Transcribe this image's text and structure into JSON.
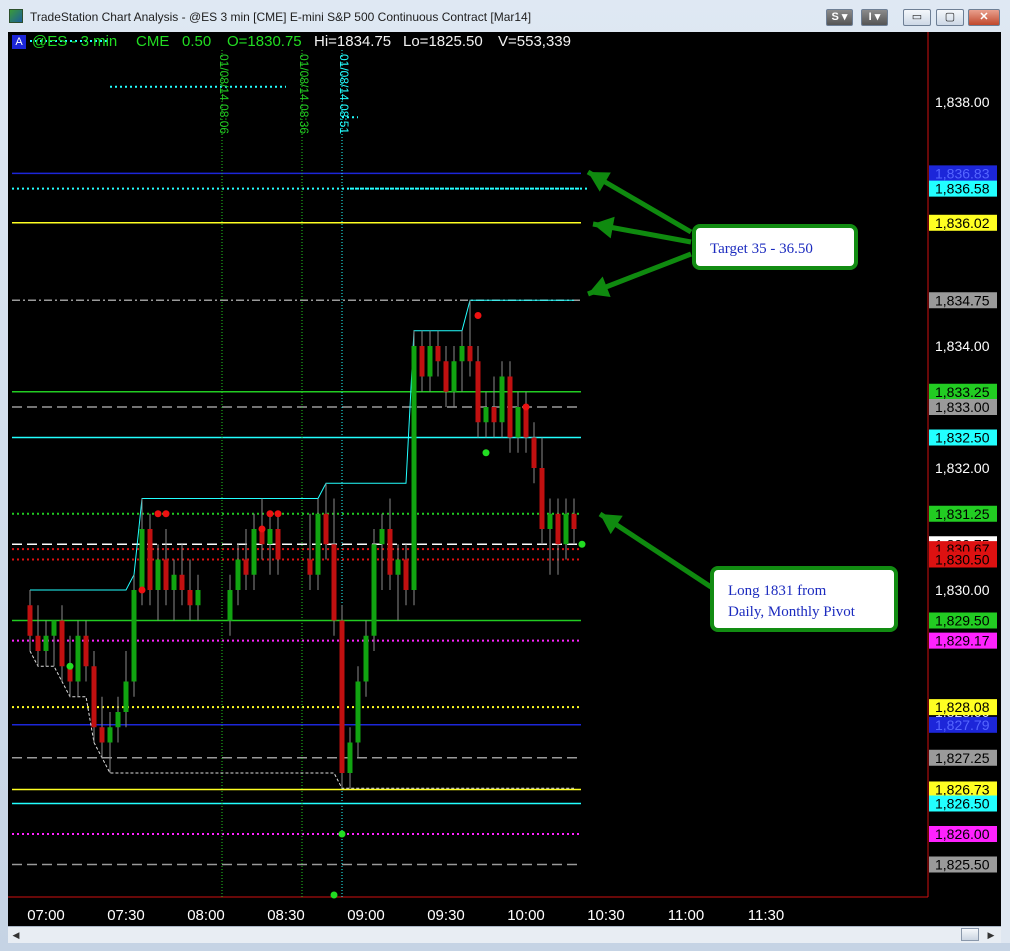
{
  "window": {
    "title": "TradeStation Chart Analysis - @ES 3 min [CME] E-mini S&P 500 Continuous Contract [Mar14]",
    "buttons": [
      "S ▾",
      "I ▾",
      "▭",
      "▢",
      "✕"
    ]
  },
  "header": {
    "a_label": "A",
    "symbol": "@ES - 3 min",
    "exchange": "CME",
    "tick": "0.50",
    "open": "O=1830.75",
    "high": "Hi=1834.75",
    "low": "Lo=1825.50",
    "volume": "V=553,339"
  },
  "colors": {
    "up": "#11a411",
    "down": "#c11010",
    "wick": "#8a8a8a",
    "blue": "#1c26d9",
    "yellow": "#ffff22",
    "green": "#22cc22",
    "cyan": "#22ffff",
    "magenta": "#ff22ff",
    "gray": "#9a9a9a",
    "arrow": "#0f8a0f"
  },
  "chart_data": {
    "type": "candlestick",
    "bar_interval_min": 3,
    "x_ticks": [
      "07:00",
      "07:30",
      "08:00",
      "08:30",
      "09:00",
      "09:30",
      "10:00",
      "10:30",
      "11:00",
      "11:30"
    ],
    "y_ticks": [
      "1,838.00",
      "1,836.00",
      "1,834.00",
      "1,832.00",
      "1,830.00",
      "1,828.00",
      "1,826.00"
    ],
    "bars": [
      {
        "t": "06:54",
        "o": 1829.75,
        "h": 1830.0,
        "l": 1829.0,
        "c": 1829.25
      },
      {
        "t": "06:57",
        "o": 1829.25,
        "h": 1829.75,
        "l": 1828.75,
        "c": 1829.0
      },
      {
        "t": "07:00",
        "o": 1829.0,
        "h": 1829.5,
        "l": 1828.75,
        "c": 1829.25
      },
      {
        "t": "07:03",
        "o": 1829.25,
        "h": 1829.5,
        "l": 1828.75,
        "c": 1829.5
      },
      {
        "t": "07:06",
        "o": 1829.5,
        "h": 1829.75,
        "l": 1828.5,
        "c": 1828.75
      },
      {
        "t": "07:09",
        "o": 1828.75,
        "h": 1829.25,
        "l": 1828.25,
        "c": 1828.5
      },
      {
        "t": "07:12",
        "o": 1828.5,
        "h": 1829.5,
        "l": 1828.25,
        "c": 1829.25
      },
      {
        "t": "07:15",
        "o": 1829.25,
        "h": 1829.5,
        "l": 1828.5,
        "c": 1828.75
      },
      {
        "t": "07:18",
        "o": 1828.75,
        "h": 1829.0,
        "l": 1827.5,
        "c": 1827.75
      },
      {
        "t": "07:21",
        "o": 1827.75,
        "h": 1828.25,
        "l": 1827.25,
        "c": 1827.5
      },
      {
        "t": "07:24",
        "o": 1827.5,
        "h": 1828.0,
        "l": 1827.0,
        "c": 1827.75
      },
      {
        "t": "07:27",
        "o": 1827.75,
        "h": 1828.25,
        "l": 1827.5,
        "c": 1828.0
      },
      {
        "t": "07:30",
        "o": 1828.0,
        "h": 1829.0,
        "l": 1827.75,
        "c": 1828.5
      },
      {
        "t": "07:33",
        "o": 1828.5,
        "h": 1830.25,
        "l": 1828.25,
        "c": 1830.0
      },
      {
        "t": "07:36",
        "o": 1830.0,
        "h": 1831.5,
        "l": 1829.75,
        "c": 1831.0
      },
      {
        "t": "07:39",
        "o": 1831.0,
        "h": 1831.25,
        "l": 1829.75,
        "c": 1830.0
      },
      {
        "t": "07:42",
        "o": 1830.0,
        "h": 1830.75,
        "l": 1829.5,
        "c": 1830.5
      },
      {
        "t": "07:45",
        "o": 1830.5,
        "h": 1831.0,
        "l": 1829.75,
        "c": 1830.0
      },
      {
        "t": "07:48",
        "o": 1830.0,
        "h": 1830.5,
        "l": 1829.5,
        "c": 1830.25
      },
      {
        "t": "07:51",
        "o": 1830.25,
        "h": 1830.75,
        "l": 1829.75,
        "c": 1830.0
      },
      {
        "t": "07:54",
        "o": 1830.0,
        "h": 1830.5,
        "l": 1829.5,
        "c": 1829.75
      },
      {
        "t": "07:57",
        "o": 1829.75,
        "h": 1830.25,
        "l": 1829.5,
        "c": 1830.0
      },
      {
        "t": "08:09",
        "o": 1829.5,
        "h": 1830.25,
        "l": 1829.25,
        "c": 1830.0
      },
      {
        "t": "08:12",
        "o": 1830.0,
        "h": 1830.75,
        "l": 1829.75,
        "c": 1830.5
      },
      {
        "t": "08:15",
        "o": 1830.5,
        "h": 1831.0,
        "l": 1830.0,
        "c": 1830.25
      },
      {
        "t": "08:18",
        "o": 1830.25,
        "h": 1831.25,
        "l": 1830.0,
        "c": 1831.0
      },
      {
        "t": "08:21",
        "o": 1831.0,
        "h": 1831.5,
        "l": 1830.5,
        "c": 1830.75
      },
      {
        "t": "08:24",
        "o": 1830.75,
        "h": 1831.25,
        "l": 1830.25,
        "c": 1831.0
      },
      {
        "t": "08:27",
        "o": 1831.0,
        "h": 1831.25,
        "l": 1830.25,
        "c": 1830.5
      },
      {
        "t": "08:39",
        "o": 1830.5,
        "h": 1831.25,
        "l": 1830.0,
        "c": 1830.25
      },
      {
        "t": "08:42",
        "o": 1830.25,
        "h": 1831.5,
        "l": 1830.0,
        "c": 1831.25
      },
      {
        "t": "08:45",
        "o": 1831.25,
        "h": 1831.75,
        "l": 1830.5,
        "c": 1830.75
      },
      {
        "t": "08:48",
        "o": 1830.75,
        "h": 1831.5,
        "l": 1829.25,
        "c": 1829.5
      },
      {
        "t": "08:51",
        "o": 1829.5,
        "h": 1829.75,
        "l": 1826.75,
        "c": 1827.0
      },
      {
        "t": "08:54",
        "o": 1827.0,
        "h": 1827.75,
        "l": 1826.75,
        "c": 1827.5
      },
      {
        "t": "08:57",
        "o": 1827.5,
        "h": 1828.75,
        "l": 1827.25,
        "c": 1828.5
      },
      {
        "t": "09:00",
        "o": 1828.5,
        "h": 1829.5,
        "l": 1828.25,
        "c": 1829.25
      },
      {
        "t": "09:03",
        "o": 1829.25,
        "h": 1831.0,
        "l": 1829.0,
        "c": 1830.75
      },
      {
        "t": "09:06",
        "o": 1830.75,
        "h": 1831.25,
        "l": 1830.0,
        "c": 1831.0
      },
      {
        "t": "09:09",
        "o": 1831.0,
        "h": 1831.5,
        "l": 1830.0,
        "c": 1830.25
      },
      {
        "t": "09:12",
        "o": 1830.25,
        "h": 1830.75,
        "l": 1829.5,
        "c": 1830.5
      },
      {
        "t": "09:15",
        "o": 1830.5,
        "h": 1830.75,
        "l": 1829.75,
        "c": 1830.0
      },
      {
        "t": "09:18",
        "o": 1830.0,
        "h": 1834.25,
        "l": 1829.75,
        "c": 1834.0
      },
      {
        "t": "09:21",
        "o": 1834.0,
        "h": 1834.25,
        "l": 1833.25,
        "c": 1833.5
      },
      {
        "t": "09:24",
        "o": 1833.5,
        "h": 1834.25,
        "l": 1833.25,
        "c": 1834.0
      },
      {
        "t": "09:27",
        "o": 1834.0,
        "h": 1834.25,
        "l": 1833.5,
        "c": 1833.75
      },
      {
        "t": "09:30",
        "o": 1833.75,
        "h": 1834.0,
        "l": 1833.0,
        "c": 1833.25
      },
      {
        "t": "09:33",
        "o": 1833.25,
        "h": 1834.0,
        "l": 1833.0,
        "c": 1833.75
      },
      {
        "t": "09:36",
        "o": 1833.75,
        "h": 1834.25,
        "l": 1833.25,
        "c": 1834.0
      },
      {
        "t": "09:39",
        "o": 1834.0,
        "h": 1834.75,
        "l": 1833.5,
        "c": 1833.75
      },
      {
        "t": "09:42",
        "o": 1833.75,
        "h": 1834.0,
        "l": 1832.5,
        "c": 1832.75
      },
      {
        "t": "09:45",
        "o": 1832.75,
        "h": 1833.25,
        "l": 1832.5,
        "c": 1833.0
      },
      {
        "t": "09:48",
        "o": 1833.0,
        "h": 1833.5,
        "l": 1832.5,
        "c": 1832.75
      },
      {
        "t": "09:51",
        "o": 1832.75,
        "h": 1833.75,
        "l": 1832.5,
        "c": 1833.5
      },
      {
        "t": "09:54",
        "o": 1833.5,
        "h": 1833.75,
        "l": 1832.25,
        "c": 1832.5
      },
      {
        "t": "09:57",
        "o": 1832.5,
        "h": 1833.25,
        "l": 1832.25,
        "c": 1833.0
      },
      {
        "t": "10:00",
        "o": 1833.0,
        "h": 1833.25,
        "l": 1832.25,
        "c": 1832.5
      },
      {
        "t": "10:03",
        "o": 1832.5,
        "h": 1832.75,
        "l": 1831.75,
        "c": 1832.0
      },
      {
        "t": "10:06",
        "o": 1832.0,
        "h": 1832.5,
        "l": 1830.75,
        "c": 1831.0
      },
      {
        "t": "10:09",
        "o": 1831.0,
        "h": 1831.5,
        "l": 1830.25,
        "c": 1831.25
      },
      {
        "t": "10:12",
        "o": 1831.25,
        "h": 1831.5,
        "l": 1830.25,
        "c": 1830.75
      },
      {
        "t": "10:15",
        "o": 1830.75,
        "h": 1831.5,
        "l": 1830.5,
        "c": 1831.25
      },
      {
        "t": "10:18",
        "o": 1831.25,
        "h": 1831.5,
        "l": 1830.75,
        "c": 1831.0
      }
    ],
    "levels": [
      {
        "price": 1836.83,
        "label": "1,836.83",
        "color": "#1c26d9",
        "text": "#5566ff",
        "style": "solid"
      },
      {
        "price": 1836.58,
        "label": "1,836.58",
        "color": "#22ffff",
        "text": "#000",
        "style": "dotted"
      },
      {
        "price": 1836.02,
        "label": "1,836.02",
        "color": "#ffff22",
        "text": "#000",
        "style": "solid"
      },
      {
        "price": 1834.75,
        "label": "1,834.75",
        "color": "#9a9a9a",
        "text": "#000",
        "style": "dashdot"
      },
      {
        "price": 1833.25,
        "label": "1,833.25",
        "color": "#22cc22",
        "text": "#000",
        "style": "solid"
      },
      {
        "price": 1833.0,
        "label": "1,833.00",
        "color": "#9a9a9a",
        "text": "#000",
        "style": "dashed"
      },
      {
        "price": 1832.5,
        "label": "1,832.50",
        "color": "#22ffff",
        "text": "#000",
        "style": "solid"
      },
      {
        "price": 1831.25,
        "label": "1,831.25",
        "color": "#22cc22",
        "text": "#000",
        "style": "dotted"
      },
      {
        "price": 1830.75,
        "label": "1,830.75",
        "color": "#ffffff",
        "text": "#000",
        "style": "dashed"
      },
      {
        "price": 1830.67,
        "label": "1,830.67",
        "color": "#dd1111",
        "text": "#000",
        "style": "dotted"
      },
      {
        "price": 1830.5,
        "label": "1,830.50",
        "color": "#dd1111",
        "text": "#000",
        "style": "dotted"
      },
      {
        "price": 1829.5,
        "label": "1,829.50",
        "color": "#22cc22",
        "text": "#000",
        "style": "solid"
      },
      {
        "price": 1829.17,
        "label": "1,829.17",
        "color": "#ff22ff",
        "text": "#000",
        "style": "dotted"
      },
      {
        "price": 1828.08,
        "label": "1,828.08",
        "color": "#ffff22",
        "text": "#000",
        "style": "dotted"
      },
      {
        "price": 1827.79,
        "label": "1,827.79",
        "color": "#1c26d9",
        "text": "#5566ff",
        "style": "solid"
      },
      {
        "price": 1827.25,
        "label": "1,827.25",
        "color": "#9a9a9a",
        "text": "#000",
        "style": "dashed"
      },
      {
        "price": 1826.73,
        "label": "1,826.73",
        "color": "#ffff22",
        "text": "#000",
        "style": "solid"
      },
      {
        "price": 1826.5,
        "label": "1,826.50",
        "color": "#22ffff",
        "text": "#000",
        "style": "solid"
      },
      {
        "price": 1826.0,
        "label": "1,826.00",
        "color": "#ff22ff",
        "text": "#000",
        "style": "dotted"
      },
      {
        "price": 1825.5,
        "label": "1,825.50",
        "color": "#9a9a9a",
        "text": "#000",
        "style": "dashed"
      }
    ],
    "price_axis_lines": [
      {
        "price": 1838.25,
        "color": "#22ffff",
        "x0": "07:24",
        "x1": "08:30"
      },
      {
        "price": 1836.58,
        "color": "#22ffff",
        "x0": "08:54",
        "x1": "10:24"
      },
      {
        "price": 1839.0,
        "color": "#22ffff",
        "x0": "06:54",
        "x1": "07:24"
      },
      {
        "price": 1837.75,
        "color": "#22ffff",
        "x0": "08:51",
        "x1": "08:57"
      }
    ],
    "vertical_markers": [
      {
        "t": "08:06",
        "label": "01/08/14 08:06",
        "color": "#22cc22"
      },
      {
        "t": "08:36",
        "label": "01/08/14 08:36",
        "color": "#22cc22"
      },
      {
        "t": "08:51",
        "label": "01/08/14 08:51",
        "color": "#22ffff"
      }
    ],
    "dots": [
      {
        "t": "07:09",
        "p": 1828.75,
        "color": "#22dd22"
      },
      {
        "t": "07:36",
        "p": 1830.0,
        "color": "#ee1111"
      },
      {
        "t": "07:42",
        "p": 1831.25,
        "color": "#ee1111"
      },
      {
        "t": "07:45",
        "p": 1831.25,
        "color": "#ee1111"
      },
      {
        "t": "08:21",
        "p": 1831.0,
        "color": "#ee1111"
      },
      {
        "t": "08:24",
        "p": 1831.25,
        "color": "#ee1111"
      },
      {
        "t": "08:27",
        "p": 1831.25,
        "color": "#ee1111"
      },
      {
        "t": "08:48",
        "p": 1825.0,
        "color": "#22dd22"
      },
      {
        "t": "08:51",
        "p": 1826.0,
        "color": "#22dd22"
      },
      {
        "t": "09:42",
        "p": 1834.5,
        "color": "#ee1111"
      },
      {
        "t": "09:45",
        "p": 1832.25,
        "color": "#22dd22"
      },
      {
        "t": "10:00",
        "p": 1833.0,
        "color": "#ee1111"
      },
      {
        "t": "10:21",
        "p": 1830.75,
        "color": "#22dd22"
      }
    ],
    "callouts": [
      {
        "lines": [
          "Target 35 - 36.50"
        ]
      },
      {
        "lines": [
          "Long 1831 from",
          "Daily, Monthly Pivot"
        ]
      }
    ]
  }
}
